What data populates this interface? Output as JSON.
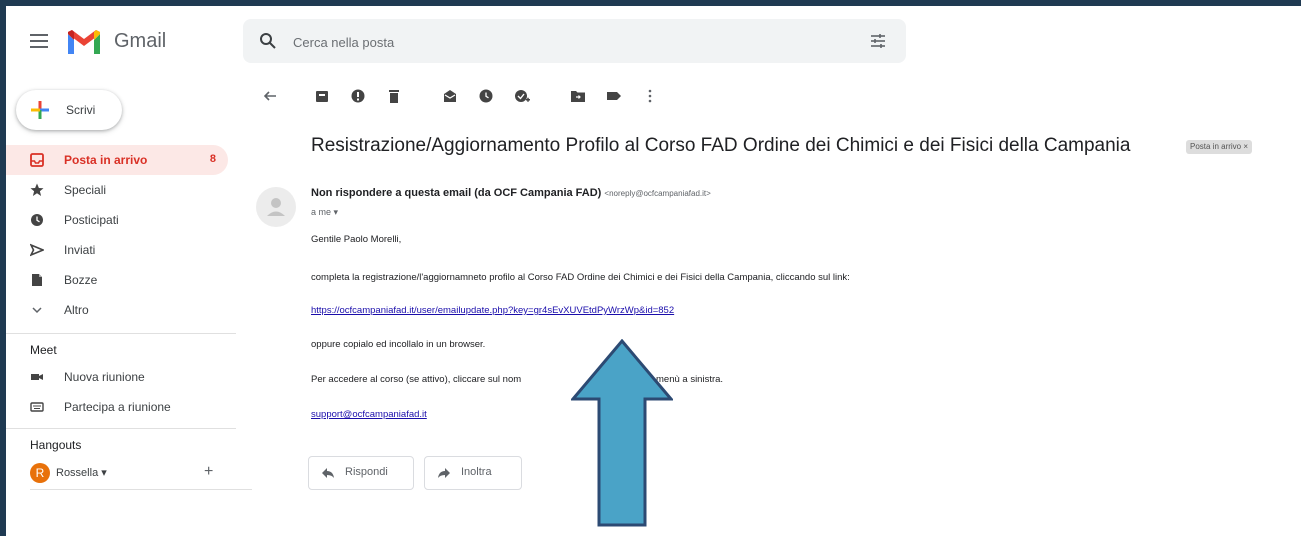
{
  "app": {
    "name": "Gmail"
  },
  "search": {
    "placeholder": "Cerca nella posta"
  },
  "compose": {
    "label": "Scrivi"
  },
  "nav": [
    {
      "label": "Posta in arrivo",
      "count": "8",
      "icon": "inbox-icon",
      "active": true
    },
    {
      "label": "Speciali",
      "icon": "star-icon"
    },
    {
      "label": "Posticipati",
      "icon": "clock-icon"
    },
    {
      "label": "Inviati",
      "icon": "send-icon"
    },
    {
      "label": "Bozze",
      "icon": "draft-icon"
    },
    {
      "label": "Altro",
      "icon": "chevron-down-icon"
    }
  ],
  "meet": {
    "title": "Meet",
    "items": [
      {
        "label": "Nuova riunione",
        "icon": "video-icon"
      },
      {
        "label": "Partecipa a riunione",
        "icon": "keyboard-icon"
      }
    ]
  },
  "hangouts": {
    "title": "Hangouts",
    "user_initial": "R",
    "user_name": "Rossella",
    "add": "+"
  },
  "message": {
    "subject": "Resistrazione/Aggiornamento Profilo al Corso FAD Ordine dei Chimici e dei Fisici della Campania",
    "label": "Posta in arrivo",
    "sender_name": "Non rispondere a questa email (da OCF Campania FAD)",
    "sender_email": "<noreply@ocfcampaniafad.it>",
    "to": "a me",
    "greeting": "Gentile Paolo Morelli,",
    "line1": "completa la registrazione/l'aggiornamneto profilo al Corso FAD Ordine dei Chimici e dei Fisici della Campania, cliccando sul link:",
    "link": "https://ocfcampaniafad.it/user/emailupdate.php?key=gr4sEvXUVEtdPyWrzWp&id=852",
    "line2": "oppure copialo ed incollalo in un browser.",
    "line3": "Per accedere al corso (se attivo), cliccare sul nom",
    "line3_end": "menù a sinistra.",
    "support": "support@ocfcampaniafad.it"
  },
  "actions": {
    "reply": "Rispondi",
    "forward": "Inoltra"
  },
  "colors": {
    "frame": "#1f3a52",
    "accent_red": "#d93025",
    "active_bg": "#fce8e6",
    "arrow_fill": "#4aa3c7",
    "arrow_stroke": "#2c4a73"
  }
}
